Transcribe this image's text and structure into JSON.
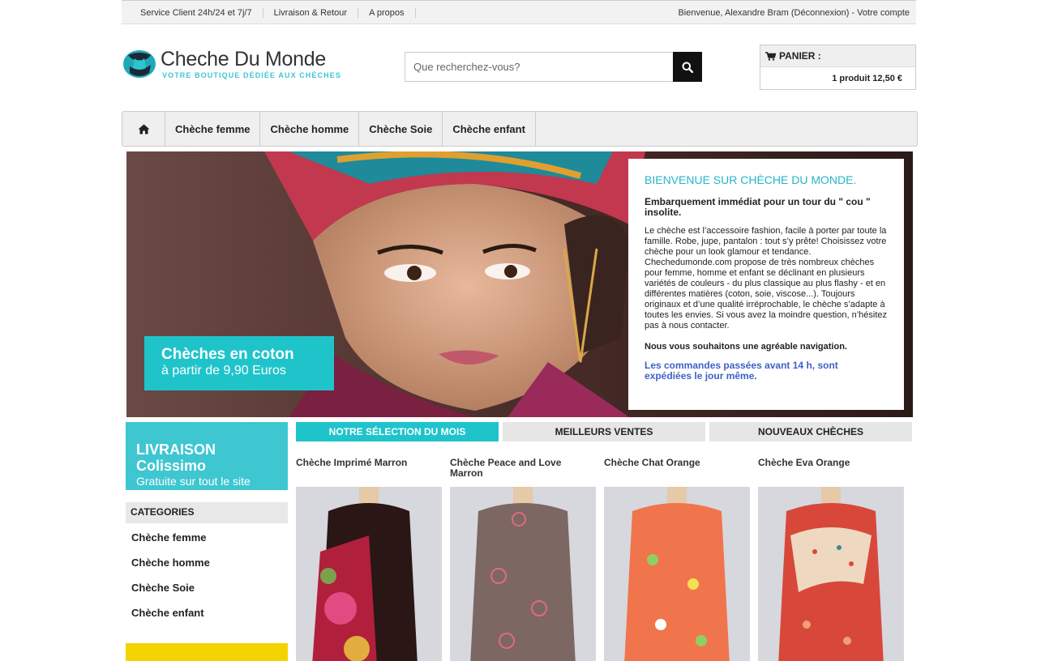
{
  "topbar": {
    "links": [
      "Service Client 24h/24 et 7j/7",
      "Livraison & Retour",
      "A propos"
    ],
    "account_text": "Bienvenue, Alexandre Bram (Déconnexion) - Votre compte"
  },
  "header": {
    "logo_name": "Cheche Du Monde",
    "logo_tagline": "VOTRE BOUTIQUE DÉDIÉE AUX CHÈCHES"
  },
  "search": {
    "placeholder": "Que recherchez-vous?",
    "icon": "search-icon"
  },
  "cart": {
    "label": "PANIER :",
    "summary": "1 produit 12,50 €",
    "icon": "cart-icon"
  },
  "nav": {
    "home_icon": "home-icon",
    "items": [
      "Chèche femme",
      "Chèche homme",
      "Chèche Soie",
      "Chèche enfant"
    ]
  },
  "hero": {
    "promo_line1": "Chèches en coton",
    "promo_line2": "à partir de 9,90 Euros"
  },
  "welcome": {
    "title": "BIENVENUE SUR CHÈCHE DU MONDE.",
    "subtitle": "Embarquement immédiat pour un tour du \" cou \" insolite.",
    "body": "Le chèche est l’accessoire fashion, facile à porter par toute la famille. Robe, jupe, pantalon : tout s’y prête! Choisissez votre chèche pour un look glamour et tendance. Chechedumonde.com propose de très nombreux chèches pour femme, homme et enfant se déclinant en plusieurs variétés de couleurs - du plus classique au plus flashy - et en différentes matières (coton, soie, viscose...). Toujours originaux et d’une qualité irréprochable, le chèche s’adapte à toutes les envies. Si vous avez la moindre question, n’hésitez pas à nous contacter.",
    "closing": "Nous vous souhaitons une agréable navigation.",
    "shipping_note": "Les commandes passées avant 14 h, sont expédiées le jour même."
  },
  "sidebar": {
    "livraison_line1": "LIVRAISON Colissimo",
    "livraison_line2": "Gratuite sur tout le site",
    "categories_title": "CATEGORIES",
    "categories": [
      "Chèche femme",
      "Chèche homme",
      "Chèche Soie",
      "Chèche enfant"
    ]
  },
  "tabs": [
    "NOTRE SÉLECTION DU MOIS",
    "MEILLEURS VENTES",
    "NOUVEAUX CHÈCHES"
  ],
  "products": [
    {
      "name": "Chèche Imprimé Marron"
    },
    {
      "name": "Chèche Peace and Love Marron"
    },
    {
      "name": "Chèche Chat Orange"
    },
    {
      "name": "Chèche Eva Orange"
    }
  ],
  "colors": {
    "accent": "#1fc4cb",
    "link_blue": "#3c62c6",
    "yellow_banner": "#f3d300"
  }
}
